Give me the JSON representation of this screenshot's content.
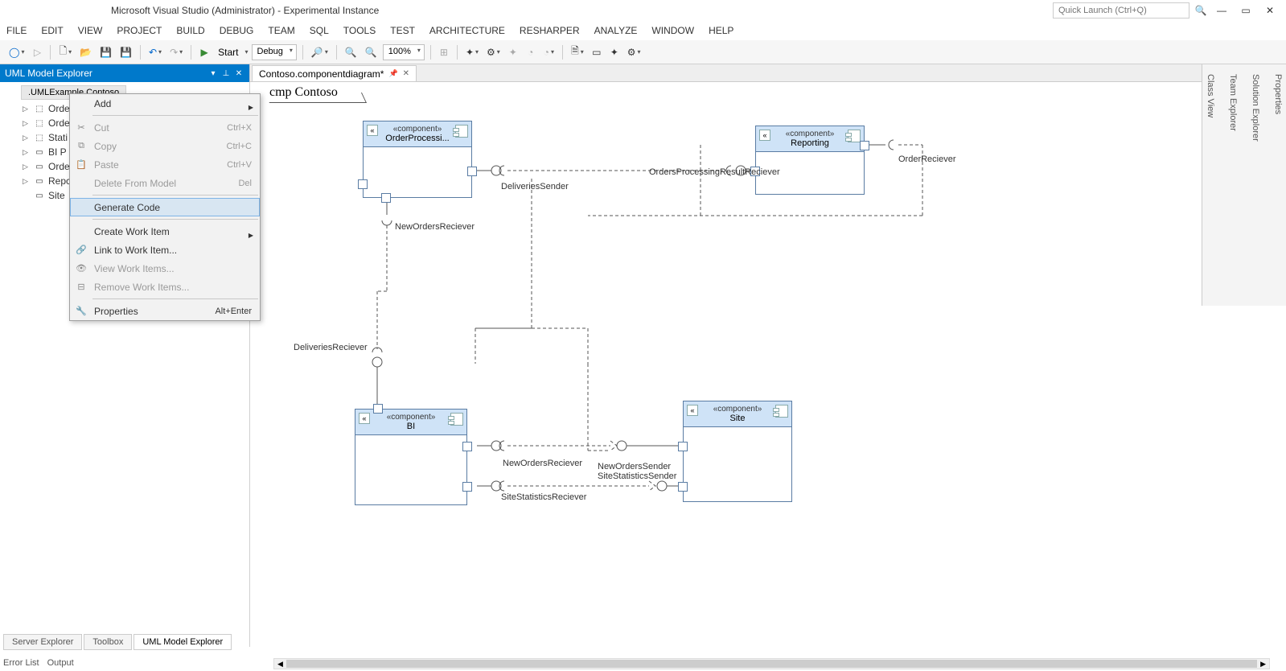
{
  "title": "Microsoft Visual Studio (Administrator) - Experimental Instance",
  "quick_launch_placeholder": "Quick Launch (Ctrl+Q)",
  "menu": [
    "FILE",
    "EDIT",
    "VIEW",
    "PROJECT",
    "BUILD",
    "DEBUG",
    "TEAM",
    "SQL",
    "TOOLS",
    "TEST",
    "ARCHITECTURE",
    "RESHARPER",
    "ANALYZE",
    "WINDOW",
    "HELP"
  ],
  "toolbar": {
    "start_label": "Start",
    "config": "Debug",
    "zoom": "100%"
  },
  "panel": {
    "title": "UML Model Explorer",
    "crumb": ".UMLExample.Contoso",
    "nodes": [
      {
        "exp": "▷",
        "icon": "⬚",
        "label": "Orde"
      },
      {
        "exp": "▷",
        "icon": "⬚",
        "label": "Orde"
      },
      {
        "exp": "▷",
        "icon": "⬚",
        "label": "Stati"
      },
      {
        "exp": "▷",
        "icon": "▭",
        "label": "BI P"
      },
      {
        "exp": "▷",
        "icon": "▭",
        "label": "Orde"
      },
      {
        "exp": "▷",
        "icon": "▭",
        "label": "Repc"
      },
      {
        "exp": "",
        "icon": "▭",
        "label": "Site"
      }
    ]
  },
  "context_menu": [
    {
      "label": "Add",
      "type": "sub"
    },
    {
      "type": "sep"
    },
    {
      "label": "Cut",
      "short": "Ctrl+X",
      "disabled": true,
      "icon": "✂"
    },
    {
      "label": "Copy",
      "short": "Ctrl+C",
      "disabled": true,
      "icon": "⧉"
    },
    {
      "label": "Paste",
      "short": "Ctrl+V",
      "disabled": true,
      "icon": "📋"
    },
    {
      "label": "Delete From Model",
      "short": "Del",
      "disabled": true
    },
    {
      "type": "sep"
    },
    {
      "label": "Generate Code",
      "hover": true
    },
    {
      "type": "sep"
    },
    {
      "label": "Create Work Item",
      "type": "sub"
    },
    {
      "label": "Link to Work Item...",
      "icon": "🔗"
    },
    {
      "label": "View Work Items...",
      "disabled": true
    },
    {
      "label": "Remove Work Items...",
      "disabled": true
    },
    {
      "type": "sep"
    },
    {
      "label": "Properties",
      "short": "Alt+Enter",
      "short_enab": true,
      "icon": "🔧"
    }
  ],
  "doc_tab": "Contoso.componentdiagram*",
  "diagram_title": "cmp Contoso",
  "components": {
    "order": {
      "stereo": "«component»",
      "name": "OrderProcessi..."
    },
    "reporting": {
      "stereo": "«component»",
      "name": "Reporting"
    },
    "bi": {
      "stereo": "«component»",
      "name": "BI"
    },
    "site": {
      "stereo": "«component»",
      "name": "Site"
    }
  },
  "labels": {
    "deliveries_sender": "DeliveriesSender",
    "orders_processing_result": "OrdersProcessingResultReciever",
    "order_reciever": "OrderReciever",
    "new_orders_reciever": "NewOrdersReciever",
    "deliveries_reciever": "DeliveriesReciever",
    "new_orders_reciever2": "NewOrdersReciever",
    "new_orders_sender": "NewOrdersSender",
    "site_stat_sender": "SiteStatisticsSender",
    "site_stat_reciever": "SiteStatisticsReciever"
  },
  "side_tabs": [
    "Properties",
    "Solution Explorer",
    "Team Explorer",
    "Class View"
  ],
  "bottom_tabs": [
    "Server Explorer",
    "Toolbox",
    "UML Model Explorer"
  ],
  "bottom_tabs2": [
    "Error List",
    "Output"
  ]
}
